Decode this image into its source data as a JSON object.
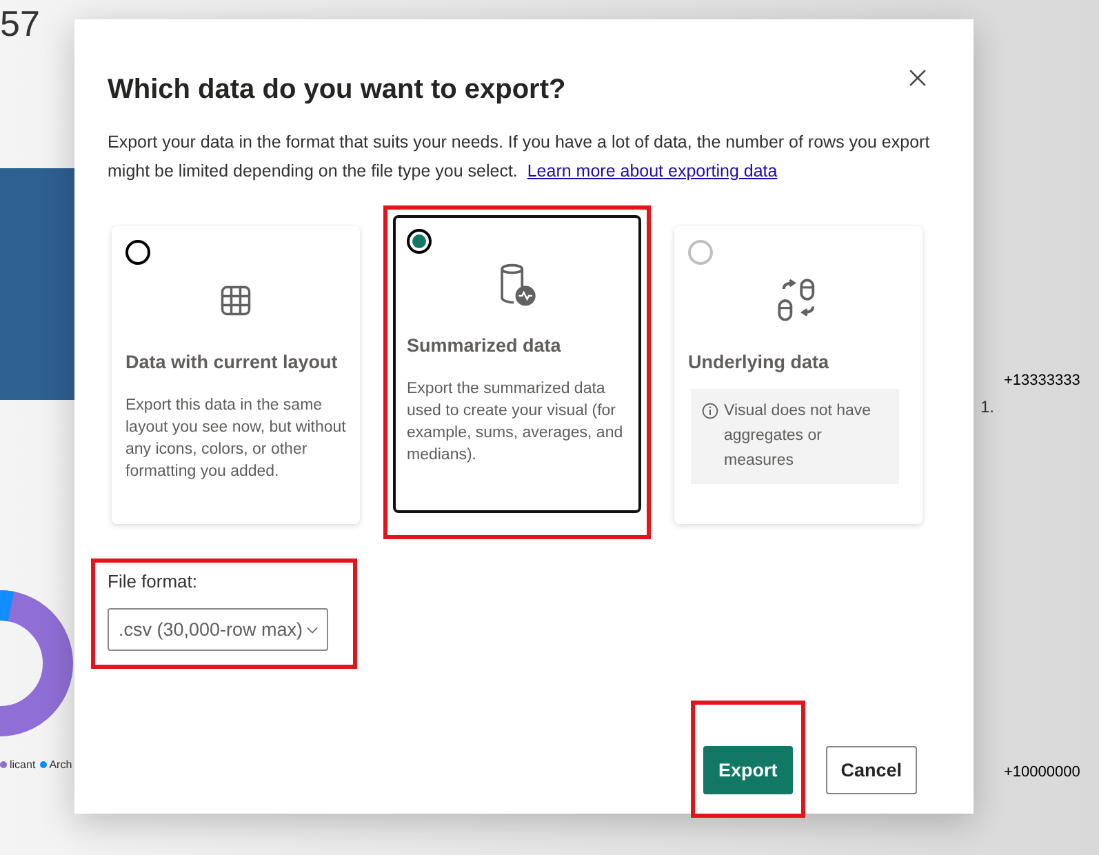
{
  "background": {
    "kpi": "57",
    "side_cells": [
      {
        "text": "1."
      }
    ],
    "numbers": [
      {
        "text": "+13333333"
      },
      {
        "text": "+10000000"
      }
    ],
    "legend": [
      {
        "text": "licant",
        "color": "#8f6fd6"
      },
      {
        "text": "Arch",
        "color": "#118dff"
      }
    ]
  },
  "dialog": {
    "title": "Which data do you want to export?",
    "description": "Export your data in the format that suits your needs. If you have a lot of data, the number of rows you export might be limited depending on the file type you select.",
    "link": "Learn more about exporting data",
    "options": [
      {
        "kind": "table",
        "title": "Data with current layout",
        "description": "Export this data in the same layout you see now, but without any icons, colors, or other formatting you added.",
        "selected": false,
        "disabled": false,
        "highlighted": false
      },
      {
        "kind": "summary",
        "title": "Summarized data",
        "description": "Export the summarized data used to create your visual (for example, sums, averages, and medians).",
        "selected": true,
        "disabled": false,
        "highlighted": true
      },
      {
        "kind": "underlying",
        "title": "Underlying data",
        "note": "Visual does not have aggregates or measures",
        "selected": false,
        "disabled": true,
        "highlighted": false
      }
    ],
    "file_format": {
      "label": "File format:",
      "value": ".csv (30,000-row max)",
      "highlighted": true
    },
    "buttons": [
      {
        "label": "Export",
        "kind": "primary",
        "highlighted": true
      },
      {
        "label": "Cancel",
        "kind": "secondary",
        "highlighted": false
      }
    ]
  }
}
